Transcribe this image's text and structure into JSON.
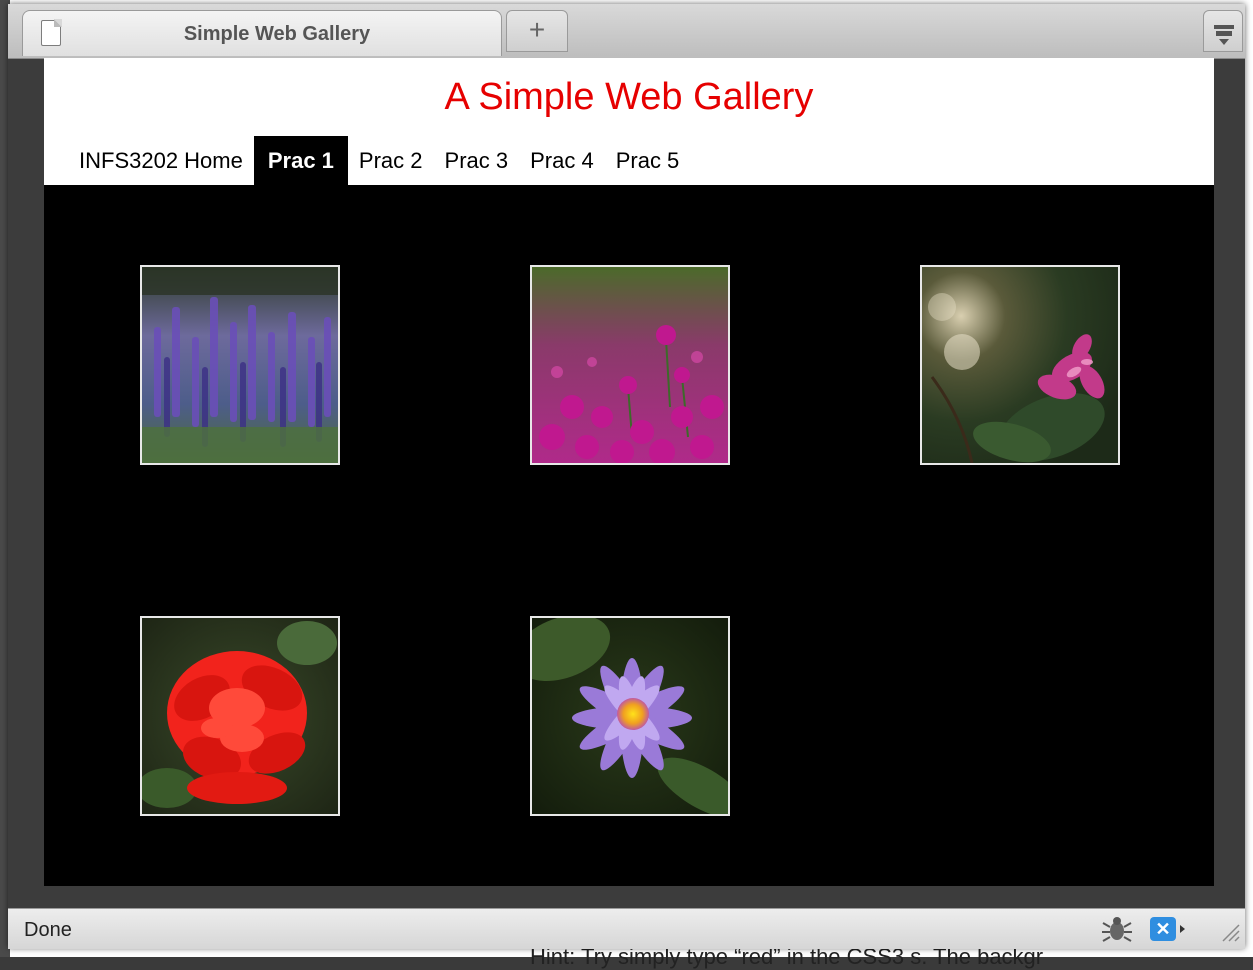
{
  "browser": {
    "tab_title": "Simple Web Gallery",
    "new_tab_label": "+",
    "status_text": "Done",
    "firebug_label": "✕"
  },
  "page": {
    "title": "A Simple Web Gallery",
    "nav": [
      {
        "label": "INFS3202 Home",
        "active": false
      },
      {
        "label": "Prac 1",
        "active": true
      },
      {
        "label": "Prac 2",
        "active": false
      },
      {
        "label": "Prac 3",
        "active": false
      },
      {
        "label": "Prac 4",
        "active": false
      },
      {
        "label": "Prac 5",
        "active": false
      }
    ],
    "gallery": [
      {
        "subject": "purple lavender salvia field"
      },
      {
        "subject": "magenta globe amaranth flowers"
      },
      {
        "subject": "pink orchid on dark green"
      },
      {
        "subject": "red hibiscus"
      },
      {
        "subject": "purple water lily"
      }
    ]
  },
  "background_document": {
    "hint_text": "Hint: Try simply type “red” in the CSS3 s. The backgr"
  },
  "colors": {
    "title_red": "#e60000",
    "page_background": "#000000",
    "nav_active_bg": "#000000",
    "thumb_border": "#e8e8e8"
  },
  "icons": {
    "tab": "page-icon",
    "tab_menu": "list-all-tabs-icon",
    "status_bug": "firebug-icon",
    "status_fb": "firebug-toggle-icon",
    "resize": "resize-grip-icon"
  }
}
